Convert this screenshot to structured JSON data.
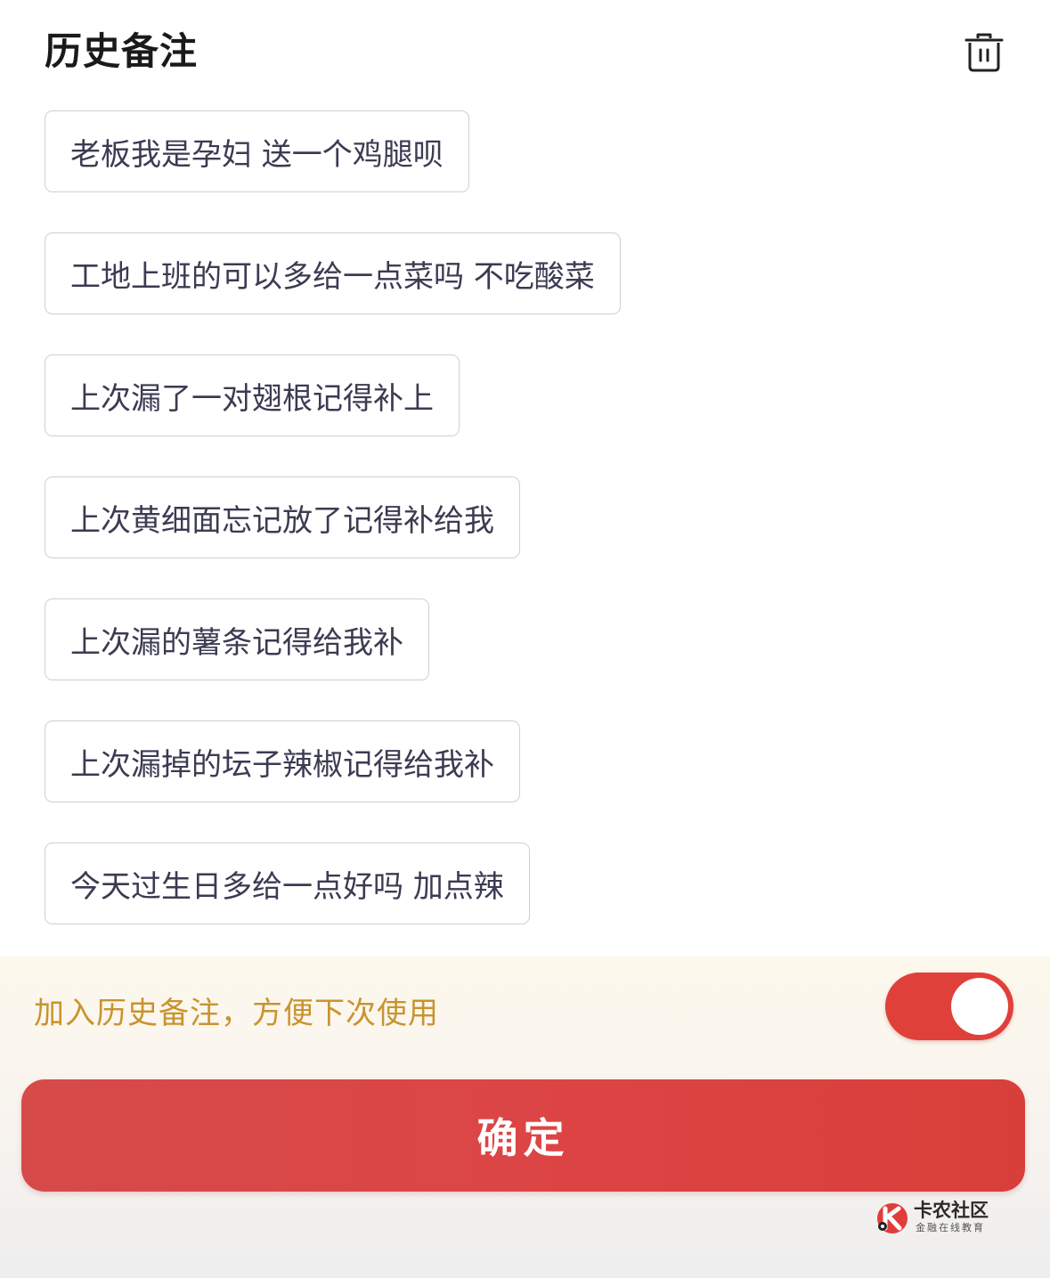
{
  "header": {
    "title": "历史备注",
    "delete_icon": "trash-icon"
  },
  "notes": [
    "老板我是孕妇 送一个鸡腿呗",
    "工地上班的可以多给一点菜吗 不吃酸菜",
    "上次漏了一对翅根记得补上",
    "上次黄细面忘记放了记得补给我",
    "上次漏的薯条记得给我补",
    "上次漏掉的坛子辣椒记得给我补",
    "今天过生日多给一点好吗 加点辣"
  ],
  "save_toggle": {
    "label": "加入历史备注，方便下次使用",
    "on": true,
    "color": "#e0403a"
  },
  "confirm_button": {
    "label": "确定",
    "color": "#dc4545"
  },
  "watermark": {
    "name": "卡农社区",
    "subtitle": "金融在线教育"
  },
  "colors": {
    "note_text": "#3b3b52",
    "note_border": "#cfcfd6",
    "toggle_label": "#c8942e"
  }
}
